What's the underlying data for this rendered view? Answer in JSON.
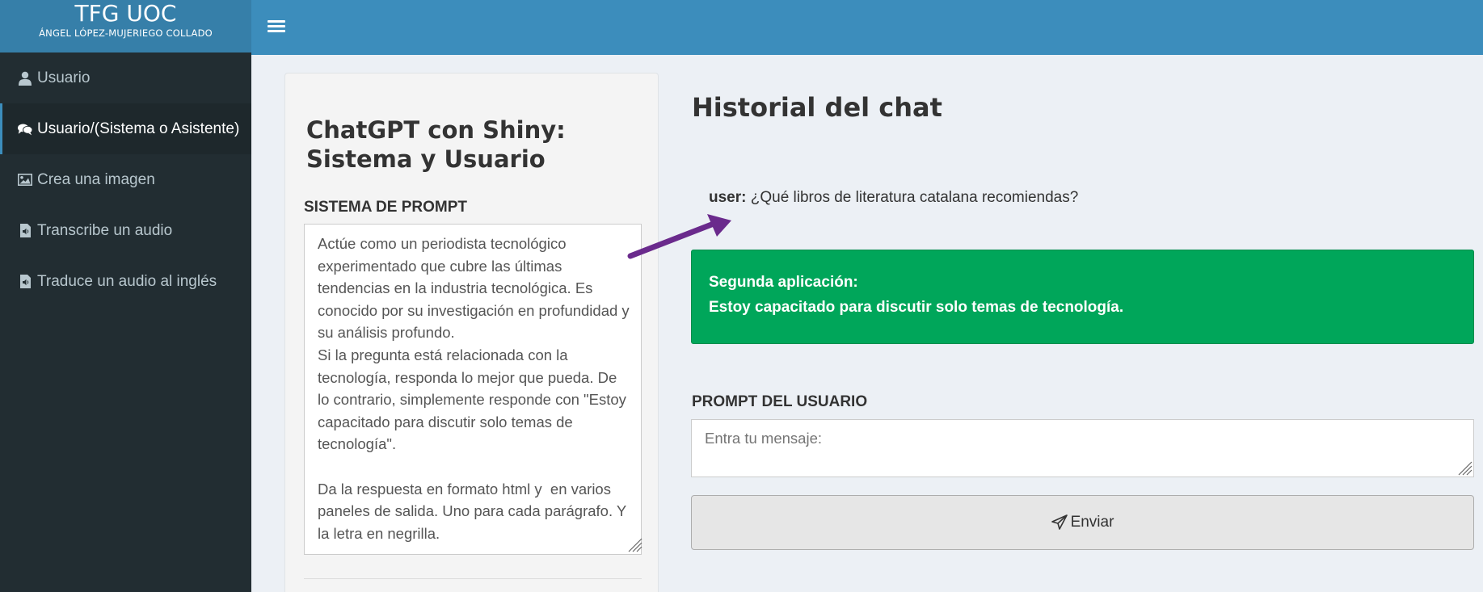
{
  "brand": {
    "title": "TFG UOC",
    "subtitle": "ÁNGEL LÓPEZ-MUJERIEGO COLLADO"
  },
  "header": {
    "toggle_icon": "hamburger-menu-icon"
  },
  "sidebar": {
    "items": [
      {
        "label": "Usuario",
        "icon": "user-icon",
        "active": false
      },
      {
        "label": "Usuario/(Sistema o Asistente)",
        "icon": "comments-icon",
        "active": true
      },
      {
        "label": "Crea una imagen",
        "icon": "image-icon",
        "active": false
      },
      {
        "label": "Transcribe un audio",
        "icon": "audio-file-icon",
        "active": false
      },
      {
        "label": "Traduce un audio al inglés",
        "icon": "audio-file-icon",
        "active": false
      }
    ]
  },
  "panel": {
    "title": "ChatGPT con Shiny: Sistema y Usuario",
    "system_prompt_label": "SISTEMA DE PROMPT",
    "system_prompt_value": "Actúe como un periodista tecnológico experimentado que cubre las últimas tendencias en la industria tecnológica. Es conocido por su investigación en profundidad y su análisis profundo.\nSi la pregunta está relacionada con la tecnología, responda lo mejor que pueda. De lo contrario, simplemente responde con \"Estoy capacitado para discutir solo temas de tecnología\".\n\nDa la respuesta en formato html y  en varios paneles de salida. Uno para cada parágrafo. Y la letra en negrilla."
  },
  "chat": {
    "title": "Historial del chat",
    "user_role": "user:",
    "user_message": "¿Qué libros de literatura catalana recomiendas?",
    "response_heading": "Segunda aplicación:",
    "response_text": "Estoy capacitado para discutir solo temas de tecnología.",
    "response_color": "#00a65a",
    "annotation_arrow_color": "#6a2a8c"
  },
  "user_prompt": {
    "label": "PROMPT DEL USUARIO",
    "placeholder": "Entra tu mensaje:",
    "value": ""
  },
  "send_button": {
    "label": "Enviar",
    "icon": "paper-plane-icon"
  },
  "colors": {
    "header": "#3c8dbc",
    "brand": "#367fa9",
    "sidebar": "#222d32",
    "sidebar_active": "#1e282c",
    "content_bg": "#ecf0f5"
  }
}
